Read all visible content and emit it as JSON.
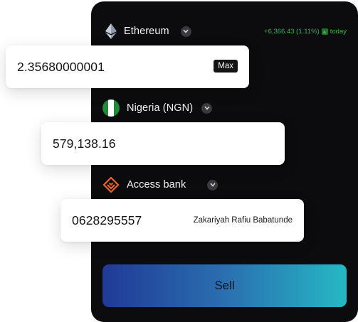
{
  "crypto": {
    "name": "Ethereum",
    "icon": "ethereum-icon"
  },
  "ticker": {
    "change": "+6,366.43 (1.11%)",
    "period": "today",
    "color": "#39b24a"
  },
  "amount": {
    "value": "2.35680000001",
    "max_label": "Max"
  },
  "country": {
    "name": "Nigeria (NGN)",
    "icon": "nigeria-flag-icon"
  },
  "fiat": {
    "value": "579,138.16"
  },
  "bank": {
    "name": "Access bank",
    "icon": "access-bank-logo-icon"
  },
  "account": {
    "number": "0628295557",
    "holder": "Zakariyah Rafiu Babatunde"
  },
  "action": {
    "sell_label": "Sell"
  },
  "colors": {
    "panel": "#0c0c0e",
    "accent_orange": "#e8632a",
    "gradient_start": "#213a96",
    "gradient_end": "#25b8c4"
  }
}
